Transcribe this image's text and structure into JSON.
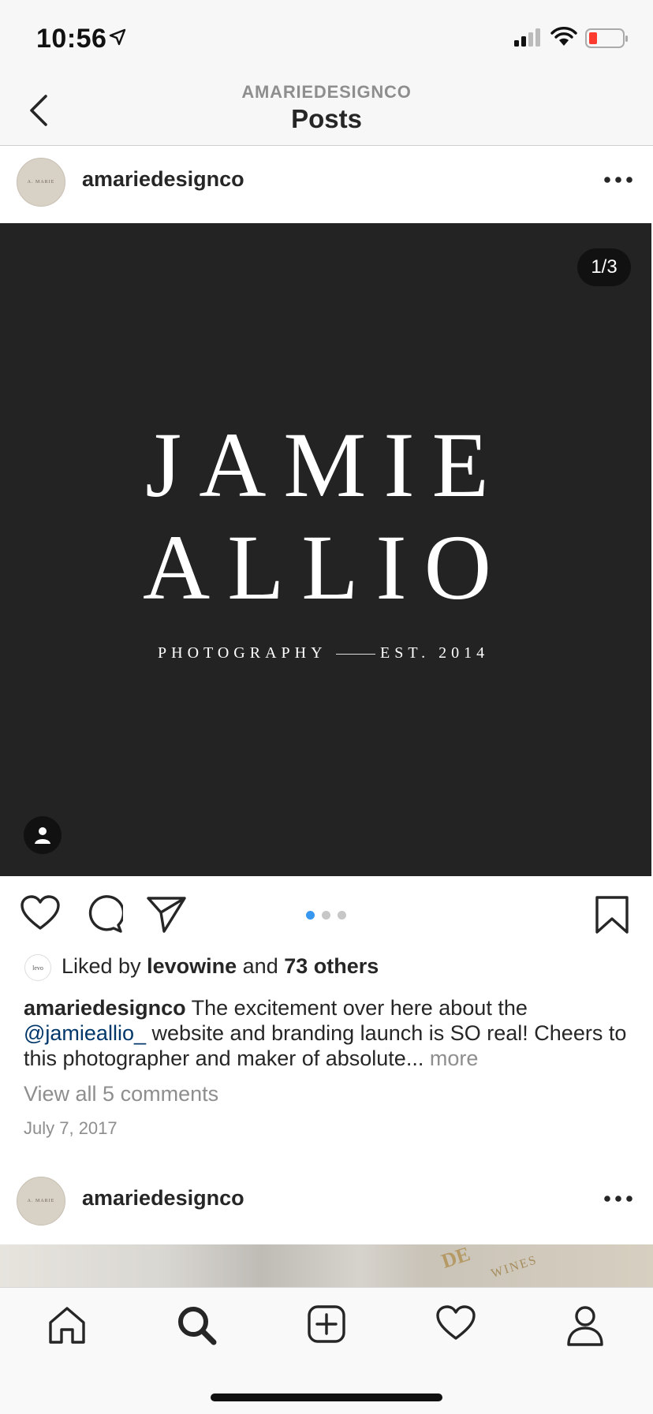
{
  "status": {
    "time": "10:56"
  },
  "nav": {
    "subtitle": "AMARIEDESIGNCO",
    "title": "Posts"
  },
  "post1": {
    "username": "amariedesignco",
    "avatar_text": "A. MARIE",
    "counter": "1/3",
    "image_text": {
      "line1": "JAMIE",
      "line2": "ALLIO",
      "sub_left": "PHOTOGRAPHY",
      "sub_right": "EST. 2014"
    },
    "likes": {
      "avatar_text": "levo",
      "prefix": "Liked by",
      "user": "levowine",
      "and": "and",
      "others": "73 others"
    },
    "caption": {
      "username": "amariedesignco",
      "text1": "The excitement over here about the",
      "mention": "@jamieallio_",
      "text2": "website and branding launch is SO real! Cheers to this photographer and maker of absolute...",
      "more": "more"
    },
    "comments_link": "View all 5 comments",
    "date": "July 7, 2017",
    "carousel": {
      "count": 3,
      "active_index": 0
    }
  },
  "post2": {
    "username": "amariedesignco",
    "avatar_text": "A. MARIE",
    "image_text1": "DE",
    "image_text2": "WINES"
  },
  "colors": {
    "link": "#00376b",
    "active_dot": "#3897f0",
    "battery_low": "#ff3b30"
  },
  "icons": {
    "back": "chevron-left-icon",
    "more": "more-horizontal-icon",
    "tag": "person-icon",
    "like": "heart-icon",
    "comment": "comment-icon",
    "share": "paper-plane-icon",
    "save": "bookmark-icon",
    "tabs": [
      "home-icon",
      "search-icon",
      "add-post-icon",
      "activity-heart-icon",
      "profile-icon"
    ]
  }
}
